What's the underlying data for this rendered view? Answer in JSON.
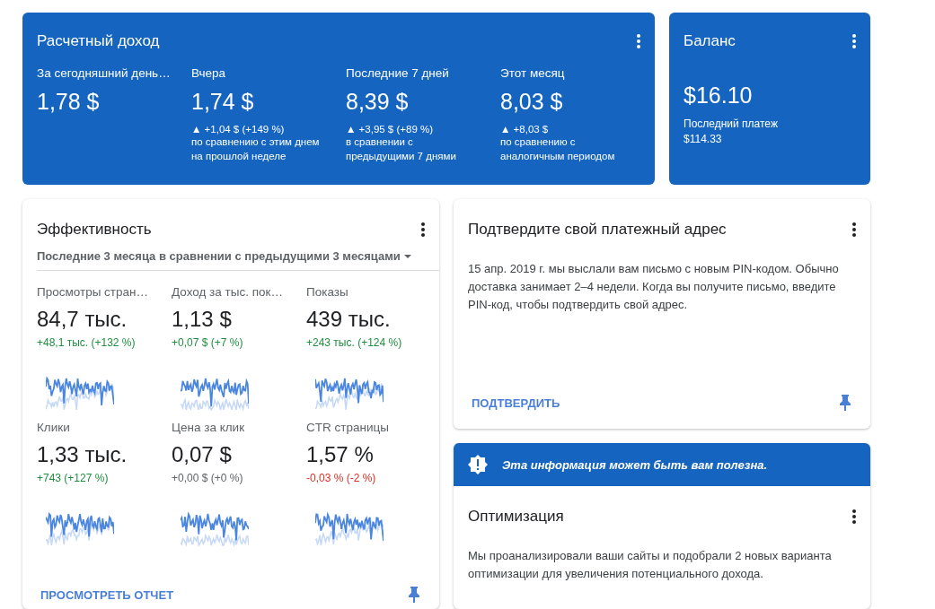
{
  "earnings": {
    "title": "Расчетный доход",
    "items": [
      {
        "label": "За сегодняшний день…",
        "value": "1,78 $"
      },
      {
        "label": "Вчера",
        "value": "1,74 $",
        "change": "▲ +1,04 $ (+149 %)",
        "note": "по сравнению с этим днем на прошлой неделе"
      },
      {
        "label": "Последние 7 дней",
        "value": "8,39 $",
        "change": "▲ +3,95 $ (+89 %)",
        "note": "в сравнении с предыдущими 7 днями"
      },
      {
        "label": "Этот месяц",
        "value": "8,03 $",
        "change": "▲ +8,03 $",
        "note": "по сравнению с аналогичным периодом"
      }
    ]
  },
  "balance": {
    "title": "Баланс",
    "value": "$16.10",
    "last_payment_label": "Последний платеж",
    "last_payment_value": "$114.33"
  },
  "performance": {
    "title": "Эффективность",
    "period": "Последние 3 месяца в сравнении с предыдущими 3 месяцами",
    "metrics": [
      {
        "label": "Просмотры стран…",
        "value": "84,7 тыс.",
        "delta": "+48,1 тыс. (+132 %)",
        "color": "#1e8e3e"
      },
      {
        "label": "Доход за тыс. пок…",
        "value": "1,13 $",
        "delta": "+0,07 $ (+7 %)",
        "color": "#1e8e3e"
      },
      {
        "label": "Показы",
        "value": "439 тыс.",
        "delta": "+243 тыс. (+124 %)",
        "color": "#1e8e3e"
      },
      {
        "label": "Клики",
        "value": "1,33 тыс.",
        "delta": "+743 (+127 %)",
        "color": "#1e8e3e"
      },
      {
        "label": "Цена за клик",
        "value": "0,07 $",
        "delta": "+0,00 $ (+0 %)",
        "color": "#5f6368"
      },
      {
        "label": "CTR страницы",
        "value": "1,57 %",
        "delta": "-0,03 % (-2 %)",
        "color": "#d93025"
      }
    ],
    "action": "ПРОСМОТРЕТЬ ОТЧЕТ"
  },
  "address": {
    "title": "Подтвердите свой платежный адрес",
    "text": "15 апр. 2019 г. мы выслали вам письмо с новым PIN-кодом. Обычно доставка занимает 2–4 недели. Когда вы получите письмо, введите PIN-код, чтобы подтвердить свой адрес.",
    "action": "ПОДТВЕРДИТЬ"
  },
  "optimization": {
    "banner": "Эта информация может быть вам полезна.",
    "title": "Оптимизация",
    "text": "Мы проанализировали ваши сайты и подобрали 2 новых варианта оптимизации для увеличения потенциального дохода."
  }
}
